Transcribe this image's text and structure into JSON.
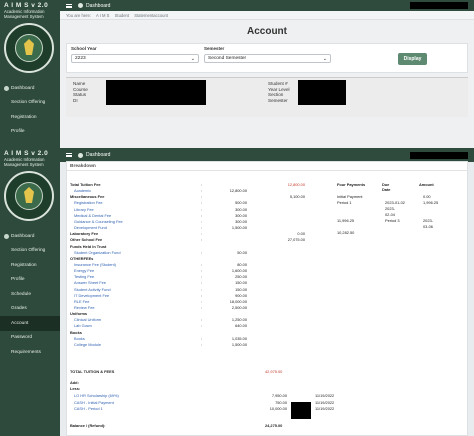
{
  "app": {
    "name": "A I M S v 2.0",
    "subtitle_line1": "Academic Information",
    "subtitle_line2": "Management System",
    "topbar_label": "Dashboard"
  },
  "screen1": {
    "nav": [
      "Dashboard",
      "Section Offering",
      "Registration",
      "Profile"
    ],
    "breadcrumb": [
      "You are here:",
      "A I M S",
      "Student",
      "Statementaccount"
    ],
    "page_title": "Account",
    "filters": {
      "school_year_label": "School Year",
      "school_year_value": "2223",
      "semester_label": "Semester",
      "semester_value": "Second Semester",
      "display_label": "Display"
    },
    "info_left": [
      "Name",
      "Course",
      "Status",
      "DI"
    ],
    "info_right": [
      "Student #",
      "Year Level",
      "Section",
      "Semester"
    ]
  },
  "screen2": {
    "nav": [
      "Dashboard",
      "Section Offering",
      "Registration",
      "Profile",
      "Schedule",
      "Grades",
      "Account",
      "Password",
      "Requirements"
    ],
    "active_nav": "Account",
    "breakdown_title": "Breakdown",
    "fees": [
      {
        "label": "Total Tuition Fee",
        "bold": true,
        "colon": ":",
        "col2": "",
        "col3": "12,800.00",
        "red": true
      },
      {
        "label": "Academic",
        "link": true,
        "colon": ":",
        "col2": "12,800.00",
        "col3": ""
      },
      {
        "label": "Miscellaneous Fee",
        "bold": true,
        "colon": ":",
        "col2": "",
        "col3": "5,100.00"
      },
      {
        "label": "Registration Fee",
        "link": true,
        "colon": ":",
        "col2": "500.00",
        "col3": ""
      },
      {
        "label": "Library Fee",
        "link": true,
        "colon": ":",
        "col2": "300.00",
        "col3": ""
      },
      {
        "label": "Medical & Dental Fee",
        "link": true,
        "colon": ":",
        "col2": "300.00",
        "col3": ""
      },
      {
        "label": "Guidance & Counseling Fee",
        "link": true,
        "colon": ":",
        "col2": "300.00",
        "col3": ""
      },
      {
        "label": "Development Fund",
        "link": true,
        "colon": ":",
        "col2": "1,500.00",
        "col3": ""
      },
      {
        "label": "Laboratory Fee",
        "bold": true,
        "colon": ":",
        "col2": "",
        "col3": "0.00"
      },
      {
        "label": "Other School Fee",
        "bold": true,
        "colon": ":",
        "col2": "",
        "col3": "27,075.00"
      },
      {
        "label": "Funds Held In Trust",
        "bold": true,
        "colon": "",
        "col2": "",
        "col3": ""
      },
      {
        "label": "Student Organization Fund",
        "link": true,
        "colon": ":",
        "col2": "50.00",
        "col3": ""
      },
      {
        "label": "OTHERFEEs",
        "bold": true,
        "colon": "",
        "col2": "",
        "col3": ""
      },
      {
        "label": "Insurance Fee (Student)",
        "link": true,
        "colon": ":",
        "col2": "80.00",
        "col3": ""
      },
      {
        "label": "Energy Fee",
        "link": true,
        "colon": ":",
        "col2": "1,600.00",
        "col3": ""
      },
      {
        "label": "Testing Fee",
        "link": true,
        "colon": ":",
        "col2": "250.00",
        "col3": ""
      },
      {
        "label": "Answer Sheet Fee",
        "link": true,
        "colon": ":",
        "col2": "150.00",
        "col3": ""
      },
      {
        "label": "Student Activity Fund",
        "link": true,
        "colon": ":",
        "col2": "150.00",
        "col3": ""
      },
      {
        "label": "IT Development Fee",
        "link": true,
        "colon": ":",
        "col2": "900.00",
        "col3": ""
      },
      {
        "label": "RLE Fee",
        "link": true,
        "colon": ":",
        "col2": "18,000.00",
        "col3": ""
      },
      {
        "label": "Review Fee",
        "link": true,
        "colon": ":",
        "col2": "2,500.00",
        "col3": ""
      },
      {
        "label": "Uniforms",
        "bold": true,
        "colon": "",
        "col2": "",
        "col3": ""
      },
      {
        "label": "Clinical Uniform",
        "link": true,
        "colon": ":",
        "col2": "1,250.00",
        "col3": ""
      },
      {
        "label": "Lab Gown",
        "link": true,
        "colon": ":",
        "col2": "640.00",
        "col3": ""
      },
      {
        "label": "Books",
        "bold": true,
        "colon": "",
        "col2": "",
        "col3": ""
      },
      {
        "label": "Books",
        "link": true,
        "colon": ":",
        "col2": "1,035.00",
        "col3": ""
      },
      {
        "label": "College Module",
        "link": true,
        "colon": ":",
        "col2": "1,500.00",
        "col3": ""
      }
    ],
    "total_label": "TOTAL TUITION & FEES",
    "total_value": "42,975.00",
    "add_label": "Add:",
    "less_label": "Less:",
    "less_items": [
      {
        "label": "LO HR Scholarship (69%)",
        "amount": "7,950.00",
        "date": "11/19/2022"
      },
      {
        "label": "CASH - Initial Payment",
        "amount": "750.00",
        "date": "11/19/2022"
      },
      {
        "label": "CASH - Period 1",
        "amount": "10,000.00",
        "date": "11/19/2022"
      }
    ],
    "balance_label": "Balance / (Refund):",
    "balance_value": "24,275.00",
    "payments": {
      "headers": [
        "Four Payments",
        "Due Date",
        "Amount"
      ],
      "rows": [
        {
          "name": "Initial Payment",
          "date": "",
          "amount": "0.00"
        },
        {
          "name": "Period 1",
          "date": "2023-01-02",
          "amount": "1,996.25"
        },
        {
          "name": "",
          "date": "2023-",
          "amount": ""
        },
        {
          "name": "",
          "date": "02-04",
          "amount": ""
        },
        {
          "name": "11,996.25",
          "date": "Period 3",
          "amount": "2023-"
        },
        {
          "name": "",
          "date": "",
          "amount": "03-06"
        },
        {
          "name": "10,282.50",
          "date": "",
          "amount": ""
        }
      ]
    }
  }
}
